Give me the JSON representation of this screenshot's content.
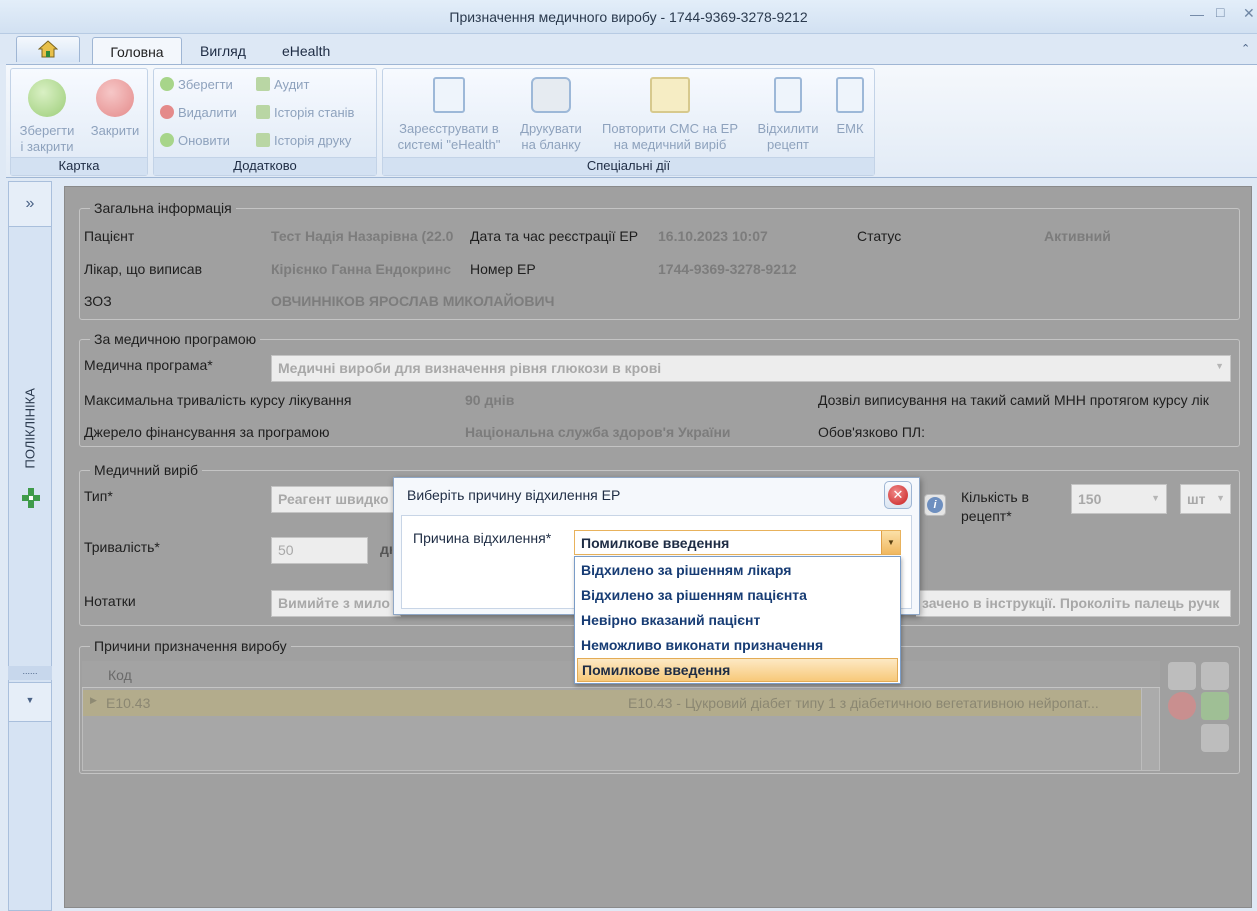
{
  "window": {
    "title": "Призначення медичного виробу - 1744-9369-3278-9212",
    "min_icon": "minimize-icon",
    "max_icon": "maximize-icon",
    "close_icon": "close-icon"
  },
  "tabs": {
    "home_icon": "home-icon",
    "main": "Головна",
    "view": "Вигляд",
    "ehealth": "eHealth",
    "collapse_icon": "chevron-up-icon"
  },
  "ribbon": {
    "card": {
      "label": "Картка",
      "save_close": "Зберегти\nі закрити",
      "close": "Закрити"
    },
    "extra": {
      "label": "Додатково",
      "save": "Зберегти",
      "delete": "Видалити",
      "refresh": "Оновити",
      "audit": "Аудит",
      "state_history": "Історія станів",
      "print_history": "Історія друку"
    },
    "special": {
      "label": "Спеціальні дії",
      "register": "Зареєструвати в\nсистемі \"eHealth\"",
      "print": "Друкувати\nна бланку",
      "resend": "Повторити СМС на ЕР\nна медичний виріб",
      "reject": "Відхилити\nрецепт",
      "emk": "ЕМК"
    }
  },
  "sidebar": {
    "expand": "»",
    "label": "ПОЛІКЛІНІКА",
    "dots": "......"
  },
  "general": {
    "legend": "Загальна інформація",
    "patient_label": "Пацієнт",
    "patient": "Тест Надія Назарівна (22.0",
    "reg_label": "Дата та час реєстрації ЕР",
    "reg": "16.10.2023 10:07",
    "status_label": "Статус",
    "status": "Активний",
    "doctor_label": "Лікар, що виписав",
    "doctor": "Кірієнко Ганна Ендокринс",
    "number_label": "Номер ЕР",
    "number": "1744-9369-3278-9212",
    "zoz_label": "ЗОЗ",
    "zoz": "ОВЧИННІКОВ ЯРОСЛАВ МИКОЛАЙОВИЧ"
  },
  "program": {
    "legend": "За медичною програмою",
    "program_label": "Медична програма*",
    "program": "Медичні вироби для визначення рівня глюкози в крові",
    "duration_label": "Максимальна тривалість курсу лікування",
    "duration": "90 днів",
    "permit_label": "Дозвіл виписування на такий самий МНН протягом курсу лік",
    "source_label": "Джерело фінансування за програмою",
    "source": "Національна служба здоров'я України",
    "pl_label": "Обов'язково ПЛ:"
  },
  "device": {
    "legend": "Медичний виріб",
    "type_label": "Тип*",
    "type": "Реагент швидко",
    "qty_label": "Кількість в\nрецепт*",
    "qty": "150",
    "unit": "шт",
    "dur_label": "Тривалість*",
    "dur": "50",
    "dur_unit": "дн",
    "notes_label": "Нотатки",
    "notes": "Вимийте з мило",
    "notes_right": "зачено в інструкції. Проколіть палець ручк"
  },
  "reasons": {
    "legend": "Причини призначення виробу",
    "col_code": "Код",
    "rows": [
      {
        "code": "E10.43",
        "desc": "E10.43 - Цукровий діабет типу 1 з діабетичною вегетативною нейропат..."
      }
    ]
  },
  "modal": {
    "title": "Виберіть причину відхилення ЕР",
    "reason_label": "Причина відхилення*",
    "selected": "Помилкове введення",
    "options": [
      "Відхилено за рішенням лікаря",
      "Відхилено за рішенням пацієнта",
      "Невірно вказаний пацієнт",
      "Неможливо виконати призначення",
      "Помилкове введення"
    ]
  }
}
